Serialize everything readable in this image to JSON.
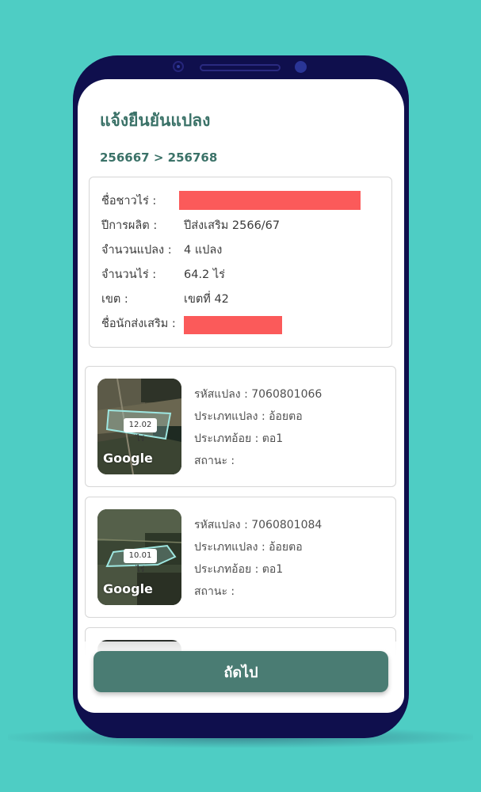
{
  "page": {
    "title": "แจ้งยืนยันแปลง",
    "breadcrumb": "256667 > 256768"
  },
  "farmer_info": {
    "farmer_name_label": "ชื่อชาวไร่ :",
    "production_year_label": "ปีการผลิต :",
    "production_year_value": "ปีส่งเสริม 2566/67",
    "plot_count_label": "จำนวนแปลง :",
    "plot_count_value": "4 แปลง",
    "rai_count_label": "จำนวนไร่ :",
    "rai_count_value": "64.2 ไร่",
    "zone_label": "เขต :",
    "zone_value": "เขตที่ 42",
    "promoter_name_label": "ชื่อนักส่งเสริม :",
    "redaction_color": "#fb5a5a"
  },
  "plots": [
    {
      "area_tag": "12.02 ไร่",
      "map_logo": "Google",
      "code": "รหัสแปลง : 7060801066",
      "plot_type": "ประเภทแปลง : อ้อยตอ",
      "cane_type": "ประเภทอ้อย : ตอ1",
      "status": "สถานะ :"
    },
    {
      "area_tag": "10.01 ไร่",
      "map_logo": "Google",
      "code": "รหัสแปลง : 7060801084",
      "plot_type": "ประเภทแปลง : อ้อยตอ",
      "cane_type": "ประเภทอ้อย : ตอ1",
      "status": "สถานะ :"
    }
  ],
  "actions": {
    "next_label": "ถัดไป"
  },
  "colors": {
    "background": "#4ecdc4",
    "device": "#0f0f4d",
    "accent": "#3b7268",
    "button": "#4a7c73"
  }
}
